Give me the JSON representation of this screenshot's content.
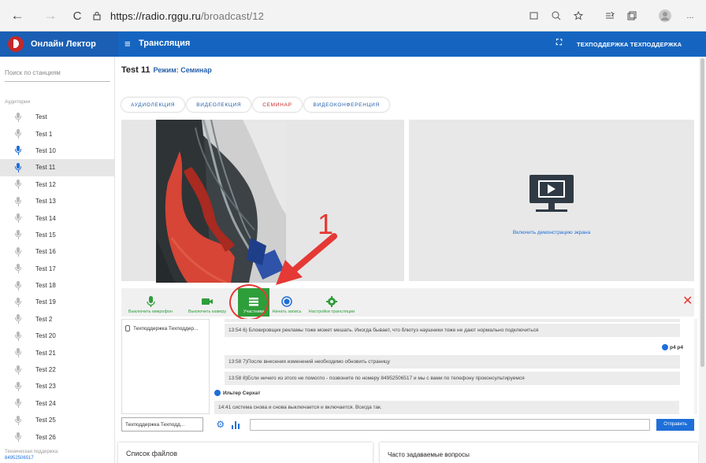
{
  "browser": {
    "url_host": "https://radio.rggu.ru",
    "url_path": "/broadcast/12",
    "back_icon": "←",
    "forward_icon": "→",
    "reload_icon": "C",
    "more_icon": "..."
  },
  "header": {
    "brand": "Онлайн Лектор",
    "title": "Трансляция",
    "user": "ТЕХПОДДЕРЖКА ТЕХПОДДЕРЖКА"
  },
  "sidebar": {
    "search_placeholder": "Поиск по станциям",
    "section_label": "Аудитории",
    "stations": [
      "Test",
      "Test 1",
      "Test 10",
      "Test 11",
      "Test 12",
      "Test 13",
      "Test 14",
      "Test 15",
      "Test 16",
      "Test 17",
      "Test 18",
      "Test 19",
      "Test 2",
      "Test 20",
      "Test 21",
      "Test 22",
      "Test 23",
      "Test 24",
      "Test 25",
      "Test 26"
    ],
    "active_station": "Test 11",
    "live_stations": [
      "Test 10",
      "Test 11"
    ],
    "support_label": "Техническая поддержка:",
    "support_phone": "84952506517"
  },
  "main": {
    "station_title": "Test 11",
    "mode_label": "Режим: Семинар",
    "modes": [
      "АУДИОЛЕКЦИЯ",
      "ВИДЕОЛЕКЦИЯ",
      "СЕМИНАР",
      "ВИДЕОКОНФЕРЕНЦИЯ"
    ],
    "active_mode": "СЕМИНАР",
    "screen_share_link": "Включить демонстрацию экрана",
    "annotation_number": "1",
    "toolbar": {
      "mic": "Выключить микрофон",
      "camera": "Выключить камеру",
      "participants": "Участники",
      "record": "Начать запись",
      "settings": "Настройки трансляции"
    },
    "participants": [
      "Техподдержка Техподдер..."
    ],
    "chat": {
      "messages_top": [
        "13:54 6) Блокировщик рекламы тоже может мешать. Иногда бывает, что блютуз наушники тоже не дают нормально подключиться"
      ],
      "p4_name": "p4 p4",
      "messages_mid": [
        "13:58 7)После внесения изменений необходимо обновить страницу",
        "13:58 8)Если ничего из этого не помогло - позвоните по номеру 84952506517 и мы с вами по телефону проконсультируемся"
      ],
      "sender": "Ильтер Серхат",
      "last_message": "14:41 система снова и снова выключается и включается. Всегда так."
    },
    "composer_name": "Техподдержка Техподд...",
    "send_label": "Отправить",
    "files_title": "Список файлов",
    "faq_title": "Часто задаваемые вопросы"
  },
  "colors": {
    "header_blue": "#1565c0",
    "link_blue": "#1e6fd9",
    "toolbar_green": "#2e9e3a",
    "annotation_red": "#e53935"
  }
}
